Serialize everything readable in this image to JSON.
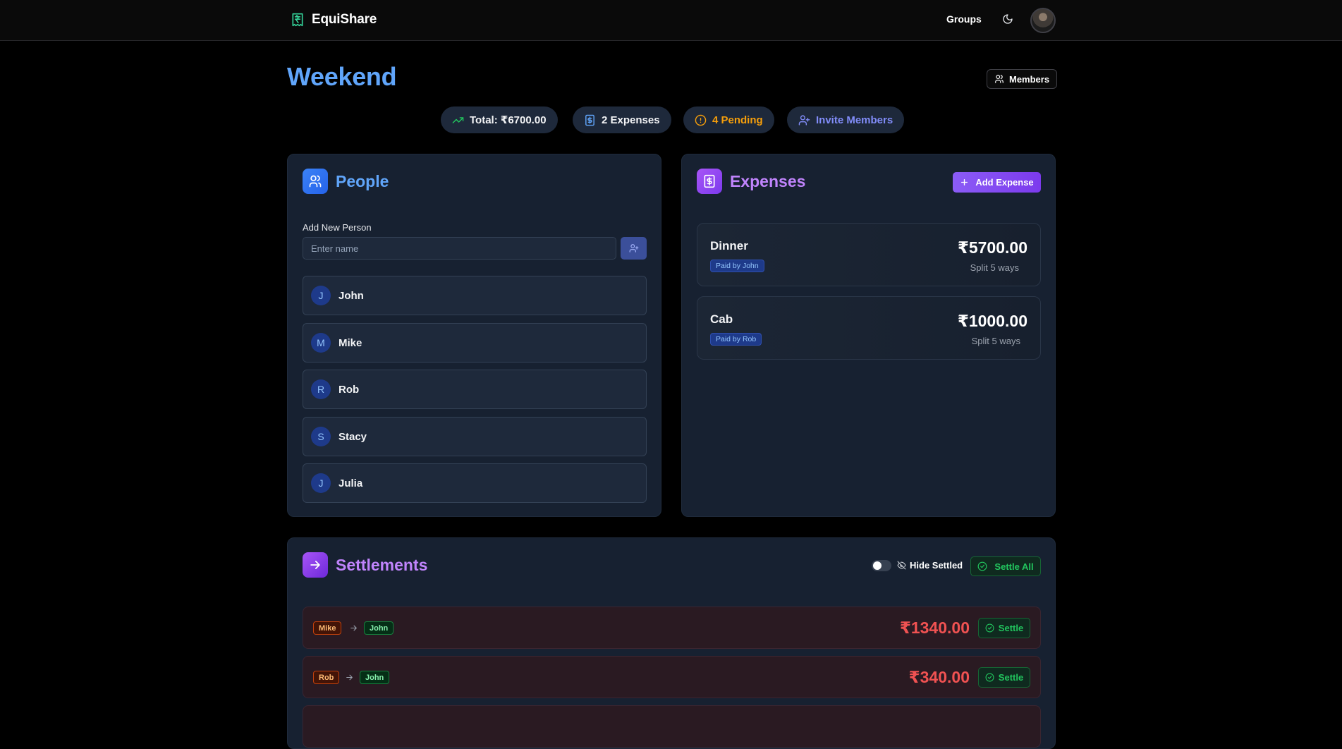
{
  "app": {
    "name": "EquiShare"
  },
  "nav": {
    "groups_label": "Groups"
  },
  "group": {
    "title": "Weekend",
    "members_label": "Members"
  },
  "stats": {
    "total": "Total: ₹6700.00",
    "expenses": "2 Expenses",
    "pending": "4 Pending",
    "invite": "Invite Members"
  },
  "people": {
    "title": "People",
    "add_label": "Add New Person",
    "input_placeholder": "Enter name",
    "list": [
      {
        "initial": "J",
        "name": "John"
      },
      {
        "initial": "M",
        "name": "Mike"
      },
      {
        "initial": "R",
        "name": "Rob"
      },
      {
        "initial": "S",
        "name": "Stacy"
      },
      {
        "initial": "J",
        "name": "Julia"
      }
    ]
  },
  "expenses": {
    "title": "Expenses",
    "add_label": "Add Expense",
    "list": [
      {
        "name": "Dinner",
        "paid_by": "Paid by John",
        "amount": "₹5700.00",
        "split": "Split 5 ways"
      },
      {
        "name": "Cab",
        "paid_by": "Paid by Rob",
        "amount": "₹1000.00",
        "split": "Split 5 ways"
      }
    ]
  },
  "settlements": {
    "title": "Settlements",
    "hide_settled_label": "Hide Settled",
    "hide_settled_on": false,
    "settle_all_label": "Settle All",
    "list": [
      {
        "from": "Mike",
        "to": "John",
        "amount": "₹1340.00",
        "action": "Settle"
      },
      {
        "from": "Rob",
        "to": "John",
        "amount": "₹340.00",
        "action": "Settle"
      }
    ]
  },
  "colors": {
    "accent_blue": "#60a5fa",
    "accent_purple": "#c084fc",
    "positive": "#22c55e",
    "warning": "#f59e0b",
    "negative": "#f05252"
  }
}
